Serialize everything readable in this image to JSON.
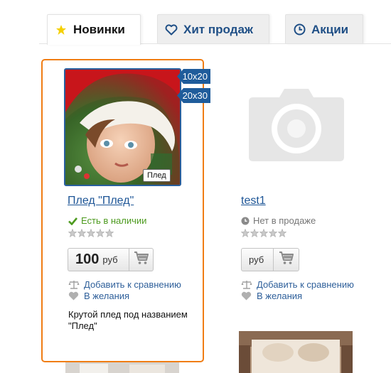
{
  "tabs": [
    {
      "label": "Новинки",
      "icon": "star-icon",
      "active": true
    },
    {
      "label": "Хит продаж",
      "icon": "heart-icon",
      "active": false
    },
    {
      "label": "Акции",
      "icon": "clock-icon",
      "active": false
    }
  ],
  "products": [
    {
      "name": "Плед \"Плед\"",
      "sizes": [
        "10x20",
        "20x30"
      ],
      "image_caption": "Плед",
      "availability": "Есть в наличии",
      "price": "100",
      "currency": "руб",
      "compare_label": "Добавить к сравнению",
      "wishlist_label": "В желания",
      "description": "Крутой плед под названием \"Плед\""
    },
    {
      "name": "test1",
      "availability": "Нет в продаже",
      "price": "",
      "currency": "руб",
      "compare_label": "Добавить к сравнению",
      "wishlist_label": "В желания"
    }
  ],
  "colors": {
    "accent_orange": "#f07d14",
    "link_blue": "#1d5596",
    "badge_blue": "#1f5c9b",
    "in_stock_green": "#4c9a1e"
  }
}
